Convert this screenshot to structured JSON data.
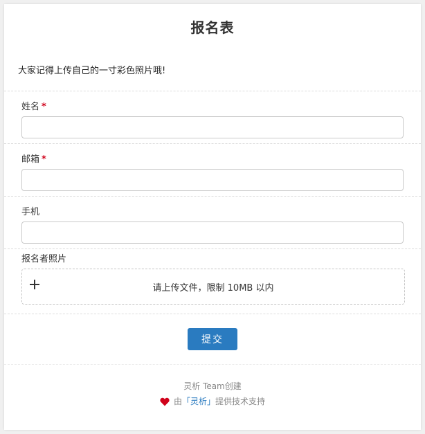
{
  "form": {
    "title": "报名表",
    "description": "大家记得上传自己的一寸彩色照片哦!",
    "required_mark": "*",
    "fields": [
      {
        "label": "姓名",
        "required": true,
        "value": "",
        "placeholder": ""
      },
      {
        "label": "邮箱",
        "required": true,
        "value": "",
        "placeholder": ""
      },
      {
        "label": "手机",
        "required": false,
        "value": "",
        "placeholder": ""
      }
    ],
    "photo": {
      "label": "报名者照片",
      "upload_hint": "请上传文件，限制 10MB 以内"
    },
    "submit_label": "提交"
  },
  "footer": {
    "created_by": "灵析 Team创建",
    "support_prefix": "由",
    "support_brand": "「灵析」",
    "support_suffix": "提供技术支持"
  },
  "colors": {
    "accent": "#2a7bc0",
    "required": "#d0021b",
    "heart": "#d0021b"
  },
  "icons": {
    "upload": "plus-icon",
    "footer": "heart-icon"
  }
}
